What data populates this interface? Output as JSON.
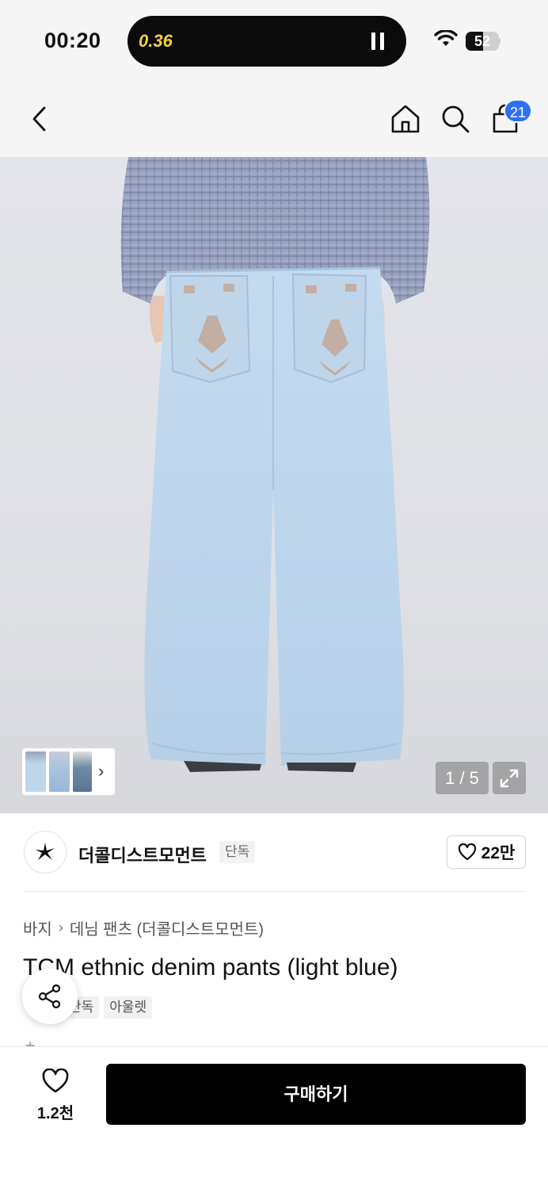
{
  "status_bar": {
    "time": "00:20",
    "live_activity_timer": "0.36",
    "battery_level": "52"
  },
  "nav": {
    "cart_count": "21",
    "icons": [
      "back-icon",
      "home-icon",
      "search-icon",
      "cart-icon"
    ]
  },
  "gallery": {
    "counter": "1 / 5",
    "current": 1,
    "total": 5
  },
  "brand": {
    "name": "더콜디스트모먼트",
    "tag": "단독",
    "followers": "22만"
  },
  "product": {
    "breadcrumb": [
      "바지",
      "데님 팬츠 (더콜디스트모먼트)"
    ],
    "title": "TCM ethnic denim pants (light blue)",
    "tags": [
      "단독",
      "아울렛"
    ]
  },
  "bottom": {
    "likes": "1.2천",
    "buy_label": "구매하기"
  },
  "colors": {
    "accent": "#2f6ff5",
    "buy_button": "#000000",
    "denim": "#bcd6ec"
  }
}
